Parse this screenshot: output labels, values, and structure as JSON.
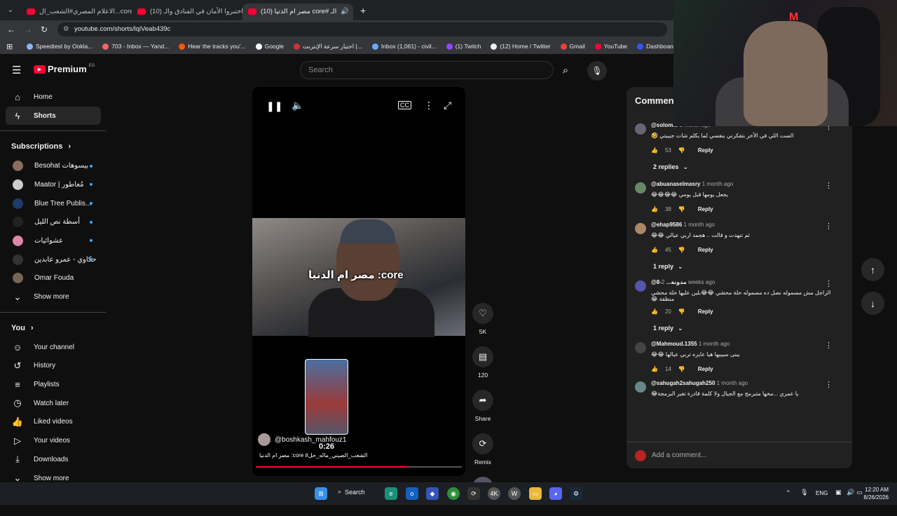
{
  "browser": {
    "tabs": [
      {
        "title": "الاعلام المصري#الشعب_ال...core#",
        "active": false
      },
      {
        "title": "(10) اختبروا الأمان في الفنادق والـ...",
        "active": false
      },
      {
        "title": "(10) مصر ام الدنيا core# الـ",
        "active": true
      }
    ],
    "new_tab_label": "+",
    "url": "youtube.com/shorts/lqiVeab439c",
    "bookmarks": [
      "Speedtest by Ookla...",
      "703 - Inbox — Yand...",
      "Hear the tracks you'...",
      "Google",
      "اختبار سرعة الإنترنت |...",
      "Inbox (1,061) - civil...",
      "(1) Twitch",
      "(12) Home / Twitter",
      "Gmail",
      "YouTube",
      "Dashboard - Restre..."
    ]
  },
  "youtube": {
    "logo": "Premium",
    "region": "EG",
    "search_placeholder": "Search",
    "sidebar": {
      "main": [
        {
          "label": "Home",
          "icon": "home-icon"
        },
        {
          "label": "Shorts",
          "icon": "shorts-icon",
          "active": true
        }
      ],
      "subscriptions_title": "Subscriptions",
      "subscriptions": [
        "Besohat بيسوهات",
        "Maator | مُعاطور",
        "Blue Tree Publis...",
        "أسطة نص الليل",
        "عشوائيات",
        "حكاوي - عمرو عابدين",
        "Omar Fouda"
      ],
      "show_more": "Show more",
      "you_title": "You",
      "you_items": [
        {
          "label": "Your channel",
          "icon": "channel-icon"
        },
        {
          "label": "History",
          "icon": "history-icon"
        },
        {
          "label": "Playlists",
          "icon": "playlists-icon"
        },
        {
          "label": "Watch later",
          "icon": "watch-later-icon"
        },
        {
          "label": "Liked videos",
          "icon": "like-icon"
        },
        {
          "label": "Your videos",
          "icon": "your-videos-icon"
        },
        {
          "label": "Downloads",
          "icon": "download-icon"
        }
      ],
      "you_show_more": "Show more"
    },
    "short": {
      "overlay_text": "مصر ام الدنيا :core",
      "time": "0:26",
      "channel": "@boshkash_mahfouz1",
      "description": "مصر ام الدنيا :core #الشعب_الصيني_ماله_حل",
      "progress": 0.74
    },
    "actions": {
      "likes": "5K",
      "comments": "120",
      "share": "Share",
      "remix": "Remix"
    },
    "comments_panel": {
      "title": "Comments",
      "add_placeholder": "Add a comment...",
      "items": [
        {
          "user": "@solom...",
          "time": "1 month ago",
          "text": "الست اللي في الآخر بتفكرني بنفسي لما بكلم شات جيبيتي 🤣",
          "likes": "53",
          "reply": "Reply",
          "replies": "2 replies"
        },
        {
          "user": "@abuanaselmasry",
          "time": "1 month ago",
          "text": "يجعل يومها قبل يومي 😂😂😂😂",
          "likes": "38",
          "reply": "Reply",
          "replies": ""
        },
        {
          "user": "@ehap9586",
          "time": "1 month ago",
          "text": "ثم تنهدت و قالت .. هجمد اربي عيالي 😂😂",
          "likes": "45",
          "reply": "Reply",
          "replies": "1 reply"
        },
        {
          "user": "@8-مدونة...",
          "time": "2 weeks ago",
          "text": "الراجل مش مسموله نصل ده مسموله حلة محشي 😂😂بلين عليها حلة محشي منظفة 😂",
          "likes": "20",
          "reply": "Reply",
          "replies": "1 reply"
        },
        {
          "user": "@Mahmoud.1355",
          "time": "1 month ago",
          "text": "يبنى سيبيها هيا عايزه تربي عيالها 😂😂",
          "likes": "14",
          "reply": "Reply",
          "replies": ""
        },
        {
          "user": "@sahugah2sahugah250",
          "time": "1 month ago",
          "text": "يا عمري ...مخها متبرمج مع الجيال ولا كلمة قادرة تغير البرمجة😂",
          "likes": "",
          "reply": "",
          "replies": ""
        }
      ]
    }
  },
  "taskbar": {
    "search": "Search",
    "lang": "ENG",
    "time": "12:20 AM",
    "date": "8/26/2026"
  }
}
